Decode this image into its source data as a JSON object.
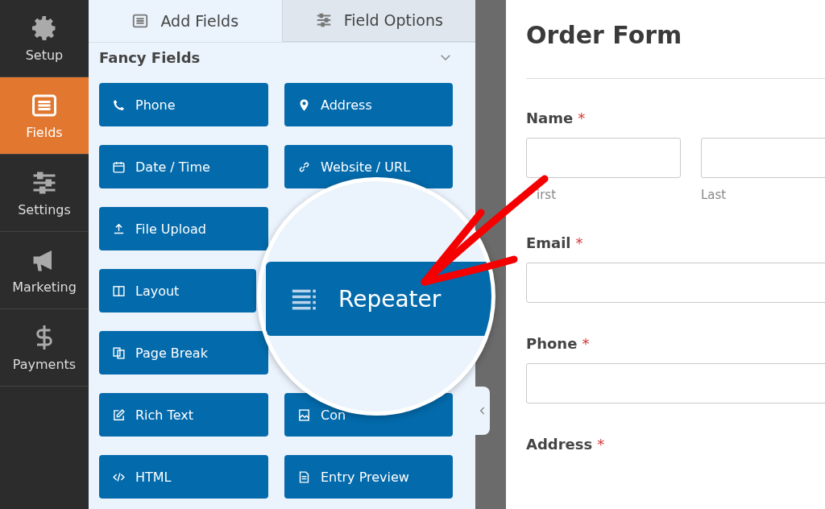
{
  "nav": [
    {
      "label": "Setup",
      "selected": false
    },
    {
      "label": "Fields",
      "selected": true
    },
    {
      "label": "Settings",
      "selected": false
    },
    {
      "label": "Marketing",
      "selected": false
    },
    {
      "label": "Payments",
      "selected": false
    }
  ],
  "tabs": [
    {
      "label": "Add Fields",
      "selected": true
    },
    {
      "label": "Field Options",
      "selected": false
    }
  ],
  "section": {
    "title": "Fancy Fields",
    "expanded": true
  },
  "fields": [
    {
      "kind": "field",
      "label": "Phone"
    },
    {
      "kind": "field",
      "label": "Address"
    },
    {
      "kind": "field",
      "label": "Date / Time"
    },
    {
      "kind": "field",
      "label": "Website / URL"
    },
    {
      "kind": "field",
      "label": "File Upload"
    },
    {
      "kind": "covered"
    },
    {
      "kind": "partial",
      "label": "Layout"
    },
    {
      "kind": "covered"
    },
    {
      "kind": "field",
      "label": "Page Break"
    },
    {
      "kind": "covered"
    },
    {
      "kind": "field",
      "label": "Rich Text"
    },
    {
      "kind": "field",
      "label": "Con"
    },
    {
      "kind": "field",
      "label": "HTML"
    },
    {
      "kind": "field",
      "label": "Entry Preview"
    }
  ],
  "magnifier": {
    "label": "Repeater"
  },
  "form": {
    "title": "Order Form",
    "fields": [
      {
        "kind": "name",
        "label": "Name",
        "mark": "*",
        "sublabels": [
          "irst",
          "Last"
        ]
      },
      {
        "kind": "text",
        "label": "Email",
        "mark": "*"
      },
      {
        "kind": "text",
        "label": "Phone",
        "mark": "*"
      },
      {
        "kind": "heading",
        "label": "Address",
        "mark": "*"
      }
    ]
  }
}
